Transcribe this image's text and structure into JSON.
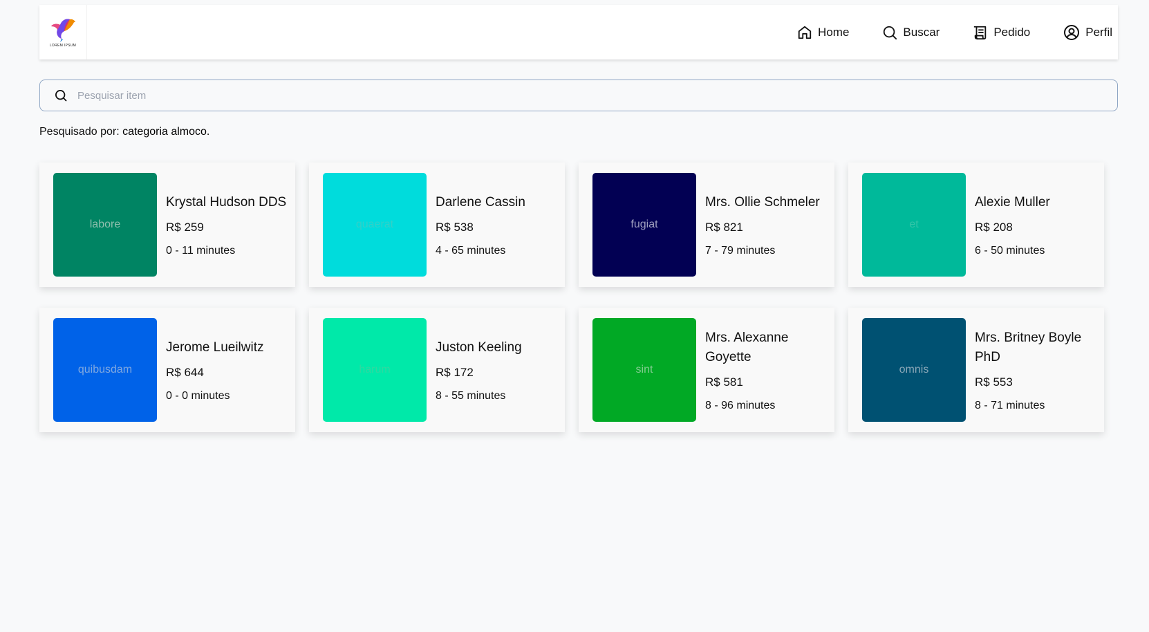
{
  "navbar": {
    "logo_text": "LOREM IPSUM",
    "items": [
      {
        "label": "Home",
        "icon": "home-icon"
      },
      {
        "label": "Buscar",
        "icon": "search-icon"
      },
      {
        "label": "Pedido",
        "icon": "receipt-icon"
      },
      {
        "label": "Perfil",
        "icon": "user-circle-icon"
      }
    ]
  },
  "search": {
    "placeholder": "Pesquisar item",
    "value": ""
  },
  "searched": {
    "prefix": "Pesquisado por: ",
    "term": "categoria almoco."
  },
  "cards": [
    {
      "name": "Krystal Hudson DDS",
      "price": "R$ 259",
      "time": "0 - 11 minutes",
      "thumb_label": "labore",
      "bg": "#008463",
      "fg": "#8fbfae"
    },
    {
      "name": "Darlene Cassin",
      "price": "R$ 538",
      "time": "4 - 65 minutes",
      "thumb_label": "quaerat",
      "bg": "#00dcdc",
      "fg": "#33d0c8"
    },
    {
      "name": "Mrs. Ollie Schmeler",
      "price": "R$ 821",
      "time": "7 - 79 minutes",
      "thumb_label": "fugiat",
      "bg": "#020053",
      "fg": "#a0a0c0"
    },
    {
      "name": "Alexie Muller",
      "price": "R$ 208",
      "time": "6 - 50 minutes",
      "thumb_label": "et",
      "bg": "#00b99a",
      "fg": "#33c5a8"
    },
    {
      "name": "Jerome Lueilwitz",
      "price": "R$ 644",
      "time": "0 - 0 minutes",
      "thumb_label": "quibusdam",
      "bg": "#0062e8",
      "fg": "#7fa8e0"
    },
    {
      "name": "Juston Keeling",
      "price": "R$ 172",
      "time": "8 - 55 minutes",
      "thumb_label": "harum",
      "bg": "#00e9a9",
      "fg": "#30d8a0"
    },
    {
      "name": "Mrs. Alexanne Goyette",
      "price": "R$ 581",
      "time": "8 - 96 minutes",
      "thumb_label": "sint",
      "bg": "#01a925",
      "fg": "#80cc90"
    },
    {
      "name": "Mrs. Britney Boyle PhD",
      "price": "R$ 553",
      "time": "8 - 71 minutes",
      "thumb_label": "omnis",
      "bg": "#005172",
      "fg": "#8aa8b8"
    }
  ]
}
